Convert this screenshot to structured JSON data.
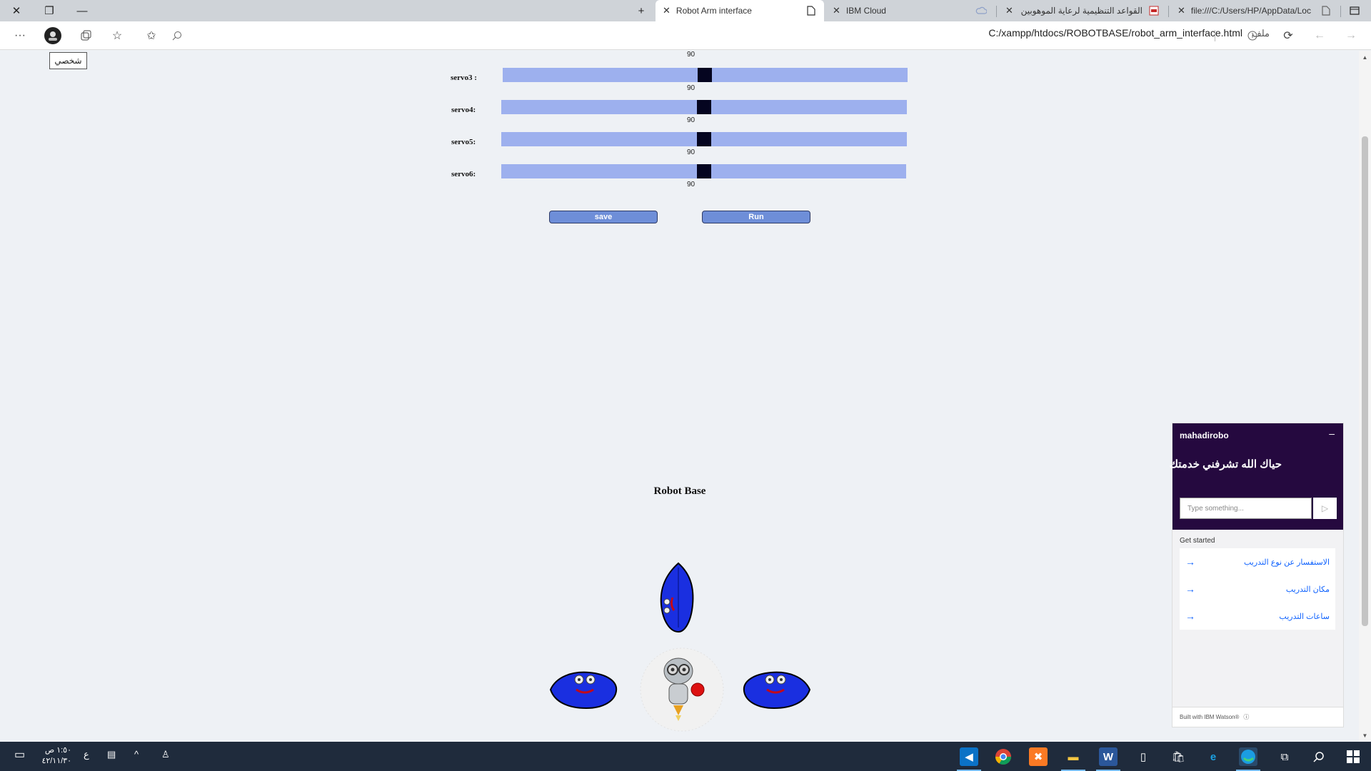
{
  "tabs": [
    {
      "title": "file:///C:/Users/HP/AppData/Loc",
      "favicon": "document-icon",
      "active": false
    },
    {
      "title": "القواعد التنظيمية لرعاية الموهوبين",
      "favicon": "pdf-icon",
      "active": false
    },
    {
      "title": "IBM Cloud",
      "favicon": "cloud-icon",
      "active": false
    },
    {
      "title": "Robot Arm interface",
      "favicon": "page-icon",
      "active": true
    }
  ],
  "toolbar": {
    "address": "C:/xampp/htdocs/ROBOTBASE/robot_arm_interface.html",
    "file_label": "ملف",
    "profile_tooltip": "شخصي"
  },
  "servos": [
    {
      "label": "servo3 :",
      "value": "90",
      "top_value": "90"
    },
    {
      "label": "servo4:",
      "value": "90"
    },
    {
      "label": "servo5:",
      "value": "90"
    },
    {
      "label": "servo6:",
      "value": "90"
    }
  ],
  "buttons": {
    "save": "save",
    "run": "Run"
  },
  "robot_base": {
    "title": "Robot Base"
  },
  "chat": {
    "name": "mahadirobo",
    "greeting": "حياك الله تشرفني خدمتك",
    "input_placeholder": "Type something...",
    "get_started": "Get started",
    "options": [
      "الاستفسار عن نوع التدريب",
      "مكان التدريب",
      "ساعات التدريب"
    ],
    "footer": "Built with IBM Watson®"
  },
  "taskbar": {
    "time": "١:٥٠ ص",
    "date": "٤٢/١١/٣٠",
    "lang": "ع"
  },
  "colors": {
    "track": "#9db0ee",
    "thumb": "#050520",
    "button": "#6e8ed8",
    "chat_header": "#25093f",
    "taskbar": "#1f2b3c"
  }
}
